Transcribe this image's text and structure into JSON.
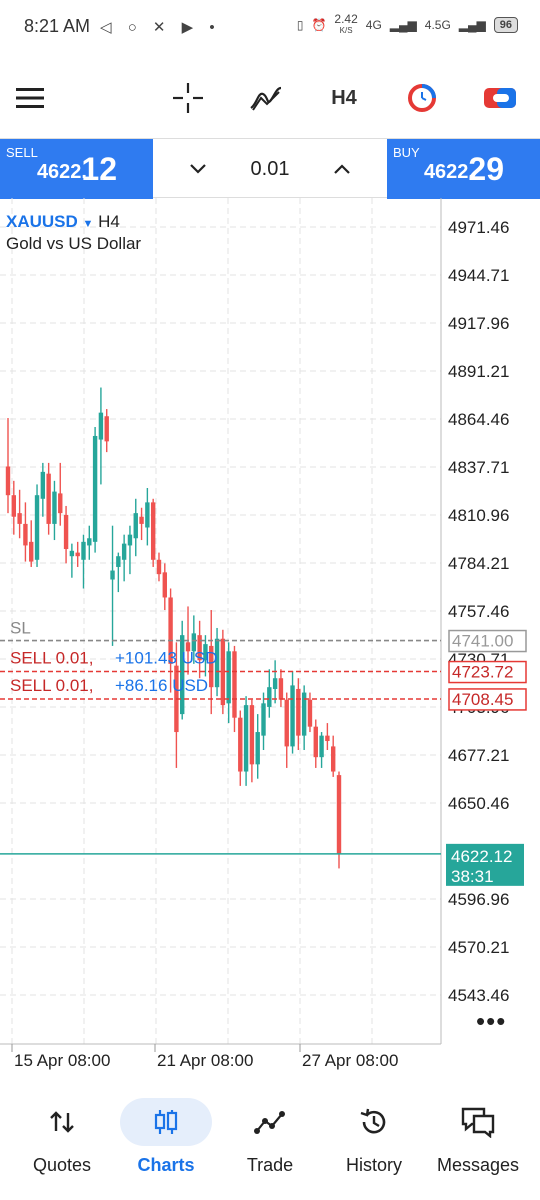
{
  "status_bar": {
    "time": "8:21 AM",
    "net_speed": "2.42",
    "net_unit": "K/S",
    "network_1": "4G",
    "network_2": "4.5G",
    "battery": "96"
  },
  "toolbar": {
    "menu_icon": "hamburger-icon",
    "crosshair_icon": "crosshair-icon",
    "indicators_icon": "indicators-icon",
    "timeframe": "H4",
    "icon_4": "clock-circle-icon",
    "icon_5": "toggle-icon"
  },
  "trade_bar": {
    "sell_label": "SELL",
    "sell_price_small": "4622.",
    "sell_price_big": "12",
    "lot": "0.01",
    "buy_label": "BUY",
    "buy_price_small": "4622.",
    "buy_price_big": "29"
  },
  "chart_header": {
    "symbol": "XAUUSD",
    "timeframe": "H4",
    "description": "Gold vs US Dollar"
  },
  "colors": {
    "bull": "#26a69a",
    "bear": "#ef5350",
    "accent": "#1a73e8",
    "trade_box": "#2f7bf0"
  },
  "chart_data": {
    "type": "candlestick",
    "symbol": "XAUUSD",
    "timeframe": "H4",
    "ylim": [
      4530,
      4985
    ],
    "y_ticks": [
      "4971.46",
      "4944.71",
      "4917.96",
      "4891.21",
      "4864.46",
      "4837.71",
      "4810.96",
      "4784.21",
      "4757.46",
      "4730.71",
      "4703.96",
      "4677.21",
      "4650.46",
      "4596.96",
      "4570.21",
      "4543.46"
    ],
    "x_labels": [
      "15 Apr 08:00",
      "21 Apr 08:00",
      "27 Apr 08:00"
    ],
    "current_price": "4622.12",
    "countdown": "38:31",
    "sl_label": "SL",
    "sl_price": "4741.00",
    "orders": [
      {
        "text": "SELL 0.01,",
        "profit": "+101.43 USD",
        "price": "4723.72"
      },
      {
        "text": "SELL 0.01,",
        "profit": "+86.16 USD",
        "price": "4708.45"
      }
    ],
    "candles": [
      {
        "o": 4838,
        "h": 4865,
        "l": 4812,
        "c": 4822
      },
      {
        "o": 4822,
        "h": 4830,
        "l": 4800,
        "c": 4810
      },
      {
        "o": 4812,
        "h": 4825,
        "l": 4798,
        "c": 4806
      },
      {
        "o": 4806,
        "h": 4818,
        "l": 4785,
        "c": 4794
      },
      {
        "o": 4796,
        "h": 4808,
        "l": 4782,
        "c": 4785
      },
      {
        "o": 4786,
        "h": 4828,
        "l": 4782,
        "c": 4822
      },
      {
        "o": 4820,
        "h": 4840,
        "l": 4810,
        "c": 4835
      },
      {
        "o": 4834,
        "h": 4840,
        "l": 4800,
        "c": 4806
      },
      {
        "o": 4806,
        "h": 4830,
        "l": 4797,
        "c": 4824
      },
      {
        "o": 4823,
        "h": 4840,
        "l": 4805,
        "c": 4812
      },
      {
        "o": 4811,
        "h": 4816,
        "l": 4784,
        "c": 4792
      },
      {
        "o": 4788,
        "h": 4795,
        "l": 4776,
        "c": 4791
      },
      {
        "o": 4790,
        "h": 4796,
        "l": 4782,
        "c": 4788
      },
      {
        "o": 4786,
        "h": 4800,
        "l": 4770,
        "c": 4796
      },
      {
        "o": 4794,
        "h": 4805,
        "l": 4786,
        "c": 4798
      },
      {
        "o": 4796,
        "h": 4860,
        "l": 4790,
        "c": 4855
      },
      {
        "o": 4853,
        "h": 4882,
        "l": 4828,
        "c": 4868
      },
      {
        "o": 4866,
        "h": 4870,
        "l": 4846,
        "c": 4852
      },
      {
        "o": 4775,
        "h": 4805,
        "l": 4738,
        "c": 4780
      },
      {
        "o": 4782,
        "h": 4790,
        "l": 4768,
        "c": 4788
      },
      {
        "o": 4786,
        "h": 4800,
        "l": 4774,
        "c": 4795
      },
      {
        "o": 4794,
        "h": 4805,
        "l": 4778,
        "c": 4800
      },
      {
        "o": 4798,
        "h": 4820,
        "l": 4788,
        "c": 4812
      },
      {
        "o": 4810,
        "h": 4815,
        "l": 4797,
        "c": 4806
      },
      {
        "o": 4804,
        "h": 4826,
        "l": 4794,
        "c": 4818
      },
      {
        "o": 4818,
        "h": 4820,
        "l": 4782,
        "c": 4786
      },
      {
        "o": 4786,
        "h": 4790,
        "l": 4774,
        "c": 4778
      },
      {
        "o": 4779,
        "h": 4784,
        "l": 4758,
        "c": 4765
      },
      {
        "o": 4765,
        "h": 4770,
        "l": 4712,
        "c": 4728
      },
      {
        "o": 4727,
        "h": 4740,
        "l": 4670,
        "c": 4690
      },
      {
        "o": 4700,
        "h": 4752,
        "l": 4697,
        "c": 4744
      },
      {
        "o": 4740,
        "h": 4760,
        "l": 4722,
        "c": 4735
      },
      {
        "o": 4735,
        "h": 4755,
        "l": 4728,
        "c": 4745
      },
      {
        "o": 4744,
        "h": 4752,
        "l": 4720,
        "c": 4730
      },
      {
        "o": 4730,
        "h": 4744,
        "l": 4721,
        "c": 4739
      },
      {
        "o": 4738,
        "h": 4758,
        "l": 4700,
        "c": 4715
      },
      {
        "o": 4715,
        "h": 4748,
        "l": 4710,
        "c": 4742
      },
      {
        "o": 4742,
        "h": 4747,
        "l": 4700,
        "c": 4705
      },
      {
        "o": 4706,
        "h": 4740,
        "l": 4695,
        "c": 4735
      },
      {
        "o": 4735,
        "h": 4738,
        "l": 4690,
        "c": 4698
      },
      {
        "o": 4698,
        "h": 4702,
        "l": 4660,
        "c": 4668
      },
      {
        "o": 4668,
        "h": 4710,
        "l": 4660,
        "c": 4705
      },
      {
        "o": 4705,
        "h": 4708,
        "l": 4662,
        "c": 4672
      },
      {
        "o": 4672,
        "h": 4700,
        "l": 4664,
        "c": 4690
      },
      {
        "o": 4688,
        "h": 4712,
        "l": 4680,
        "c": 4706
      },
      {
        "o": 4704,
        "h": 4725,
        "l": 4698,
        "c": 4715
      },
      {
        "o": 4714,
        "h": 4730,
        "l": 4706,
        "c": 4720
      },
      {
        "o": 4720,
        "h": 4725,
        "l": 4704,
        "c": 4708
      },
      {
        "o": 4708,
        "h": 4712,
        "l": 4670,
        "c": 4682
      },
      {
        "o": 4682,
        "h": 4724,
        "l": 4678,
        "c": 4716
      },
      {
        "o": 4714,
        "h": 4720,
        "l": 4680,
        "c": 4688
      },
      {
        "o": 4688,
        "h": 4716,
        "l": 4680,
        "c": 4712
      },
      {
        "o": 4708,
        "h": 4712,
        "l": 4690,
        "c": 4693
      },
      {
        "o": 4693,
        "h": 4697,
        "l": 4670,
        "c": 4676
      },
      {
        "o": 4676,
        "h": 4690,
        "l": 4670,
        "c": 4688
      },
      {
        "o": 4688,
        "h": 4695,
        "l": 4680,
        "c": 4685
      },
      {
        "o": 4682,
        "h": 4688,
        "l": 4665,
        "c": 4668
      },
      {
        "o": 4666,
        "h": 4668,
        "l": 4614,
        "c": 4622
      }
    ]
  },
  "bottom_nav": [
    {
      "label": "Quotes",
      "icon": "arrows-updown-icon"
    },
    {
      "label": "Charts",
      "icon": "candles-icon"
    },
    {
      "label": "Trade",
      "icon": "trade-line-icon"
    },
    {
      "label": "History",
      "icon": "history-icon"
    },
    {
      "label": "Messages",
      "icon": "messages-icon"
    }
  ]
}
